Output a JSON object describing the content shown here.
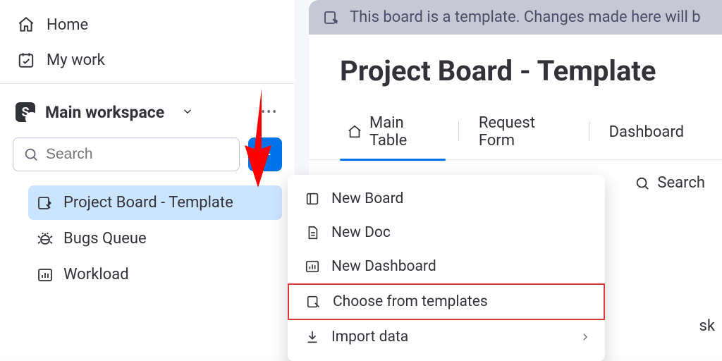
{
  "sidebar": {
    "nav": [
      {
        "label": "Home"
      },
      {
        "label": "My work"
      }
    ],
    "workspace": {
      "badge": "S",
      "name": "Main workspace"
    },
    "search": {
      "placeholder": "Search"
    },
    "boards": [
      {
        "label": "Project Board - Template",
        "selected": true,
        "icon": "template"
      },
      {
        "label": "Bugs Queue",
        "selected": false,
        "icon": "bug"
      },
      {
        "label": "Workload",
        "selected": false,
        "icon": "chart"
      }
    ]
  },
  "main": {
    "banner": "This board is a template. Changes made here will b",
    "title": "Project Board - Template",
    "tabs": [
      {
        "label": "Main Table",
        "active": true
      },
      {
        "label": "Request Form",
        "active": false
      },
      {
        "label": "Dashboard",
        "active": false
      }
    ],
    "toolbar": {
      "search_label": "Search"
    },
    "task_fragment": "sk"
  },
  "dropdown": {
    "items": [
      {
        "label": "New Board",
        "icon": "board"
      },
      {
        "label": "New Doc",
        "icon": "doc"
      },
      {
        "label": "New Dashboard",
        "icon": "dashboard"
      },
      {
        "label": "Choose from templates",
        "icon": "template",
        "highlighted": true
      },
      {
        "label": "Import data",
        "icon": "import",
        "has_submenu": true
      }
    ]
  }
}
